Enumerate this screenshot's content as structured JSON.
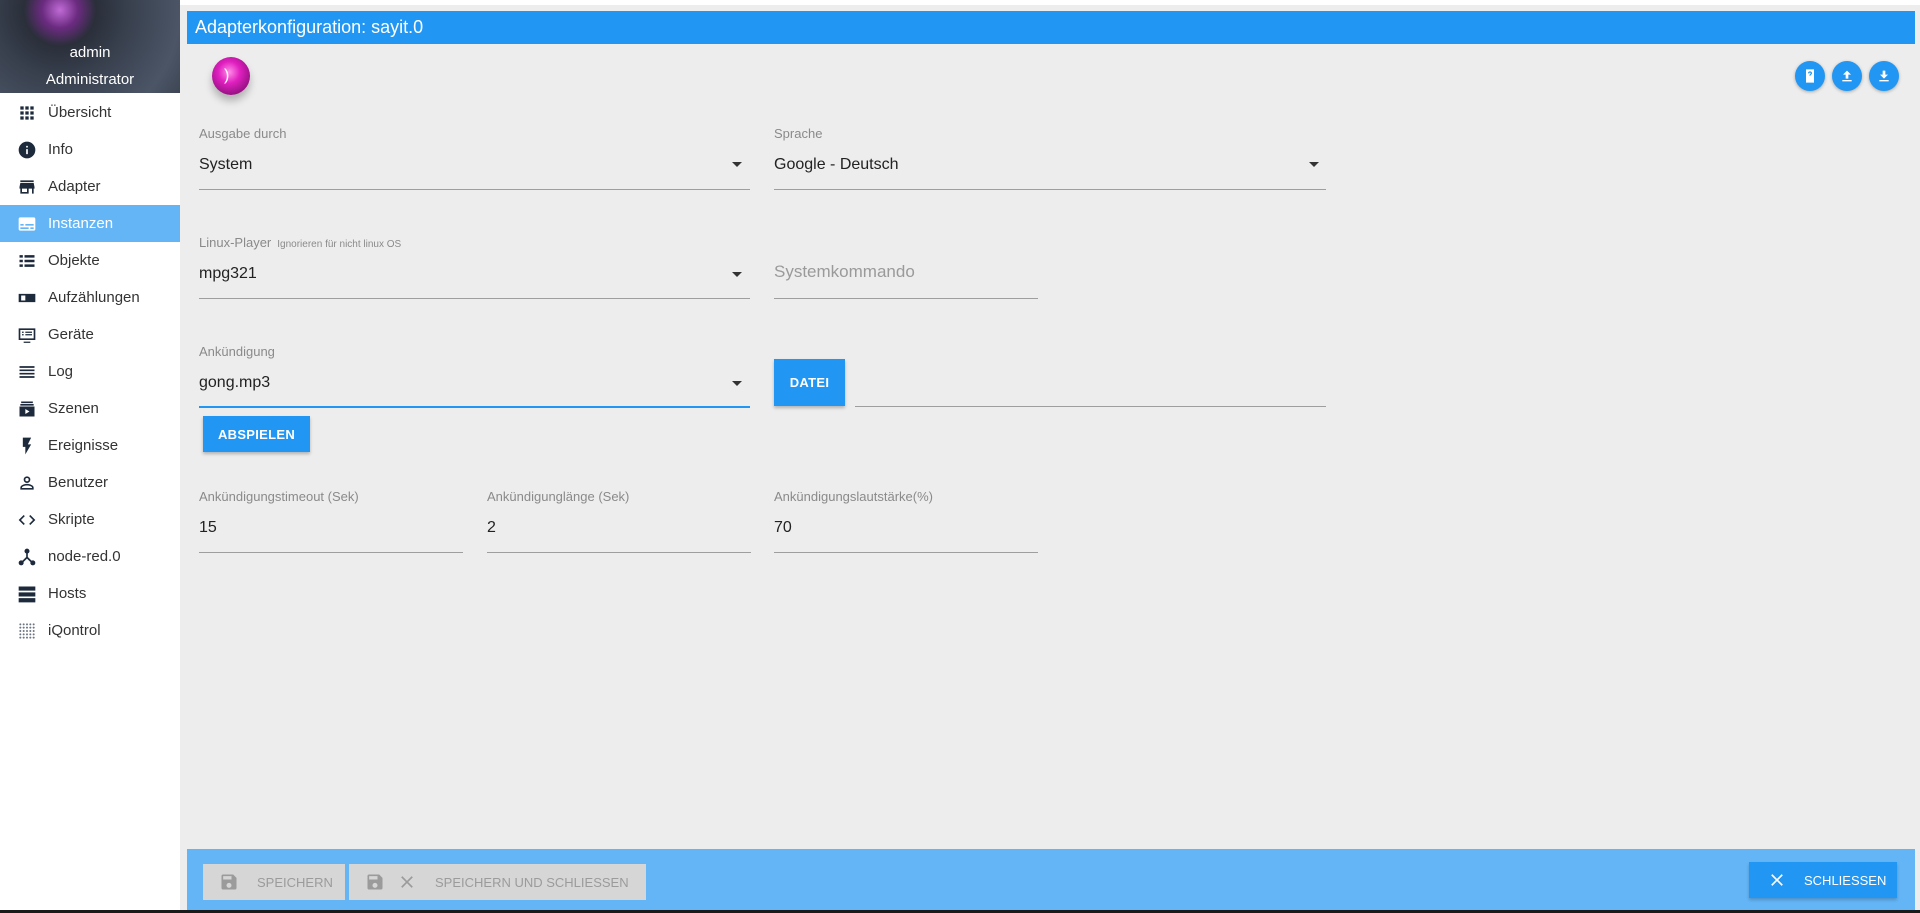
{
  "user": {
    "name": "admin",
    "role": "Administrator"
  },
  "nav": [
    {
      "label": "Übersicht",
      "icon": "grid-icon"
    },
    {
      "label": "Info",
      "icon": "info-icon"
    },
    {
      "label": "Adapter",
      "icon": "store-icon"
    },
    {
      "label": "Instanzen",
      "icon": "subtitles-icon",
      "active": true
    },
    {
      "label": "Objekte",
      "icon": "list-icon"
    },
    {
      "label": "Aufzählungen",
      "icon": "enum-icon"
    },
    {
      "label": "Geräte",
      "icon": "devices-icon"
    },
    {
      "label": "Log",
      "icon": "log-icon"
    },
    {
      "label": "Szenen",
      "icon": "scenes-icon"
    },
    {
      "label": "Ereignisse",
      "icon": "flash-icon"
    },
    {
      "label": "Benutzer",
      "icon": "person-icon"
    },
    {
      "label": "Skripte",
      "icon": "code-icon"
    },
    {
      "label": "node-red.0",
      "icon": "node-icon"
    },
    {
      "label": "Hosts",
      "icon": "hosts-icon"
    },
    {
      "label": "iQontrol",
      "icon": "dots-icon"
    }
  ],
  "title": "Adapterkonfiguration: sayit.0",
  "form": {
    "ausgabe": {
      "label": "Ausgabe durch",
      "value": "System"
    },
    "sprache": {
      "label": "Sprache",
      "value": "Google - Deutsch"
    },
    "player": {
      "label": "Linux-Player",
      "hint": "Ignorieren für nicht linux OS",
      "value": "mpg321"
    },
    "systemkommando": {
      "placeholder": "Systemkommando"
    },
    "ankuendigung": {
      "label": "Ankündigung",
      "value": "gong.mp3"
    },
    "datei_button": "DATEI",
    "abspielen_button": "ABSPIELEN",
    "timeout": {
      "label": "Ankündigungstimeout (Sek)",
      "value": "15"
    },
    "laenge": {
      "label": "Ankündigunglänge (Sek)",
      "value": "2"
    },
    "lautstaerke": {
      "label": "Ankündigungslautstärke(%)",
      "value": "70"
    }
  },
  "footer": {
    "save": "SPEICHERN",
    "save_close": "SPEICHERN UND SCHLIESSEN",
    "close": "SCHLIESSEN"
  },
  "colors": {
    "accent": "#2196f3",
    "active_nav": "#64b5f6",
    "footer": "#64b5f6"
  }
}
